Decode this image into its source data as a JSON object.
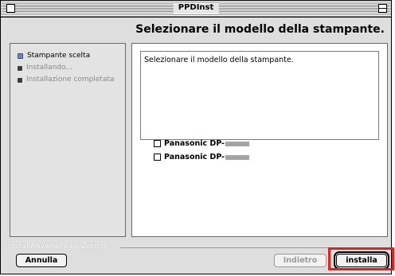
{
  "window": {
    "title": "PPDInst"
  },
  "header": {
    "title": "Selezionare il modello della stampante."
  },
  "steps": [
    {
      "label": "Stampante scelta",
      "state": "active"
    },
    {
      "label": "Installando...",
      "state": "pending"
    },
    {
      "label": "Installazione completata",
      "state": "pending"
    }
  ],
  "main": {
    "message": "Selezionare il modello della stampante.",
    "options": [
      {
        "label": "Panasonic DP-",
        "checked": false
      },
      {
        "label": "Panasonic DP-",
        "checked": false
      }
    ]
  },
  "footer": {
    "brand": "InstallAnywhere by Zero G",
    "cancel_label": "Annulla",
    "back_label": "Indietro",
    "install_label": "installa"
  },
  "colors": {
    "highlight": "#e0221f",
    "active_bullet": "#6f86b8"
  }
}
